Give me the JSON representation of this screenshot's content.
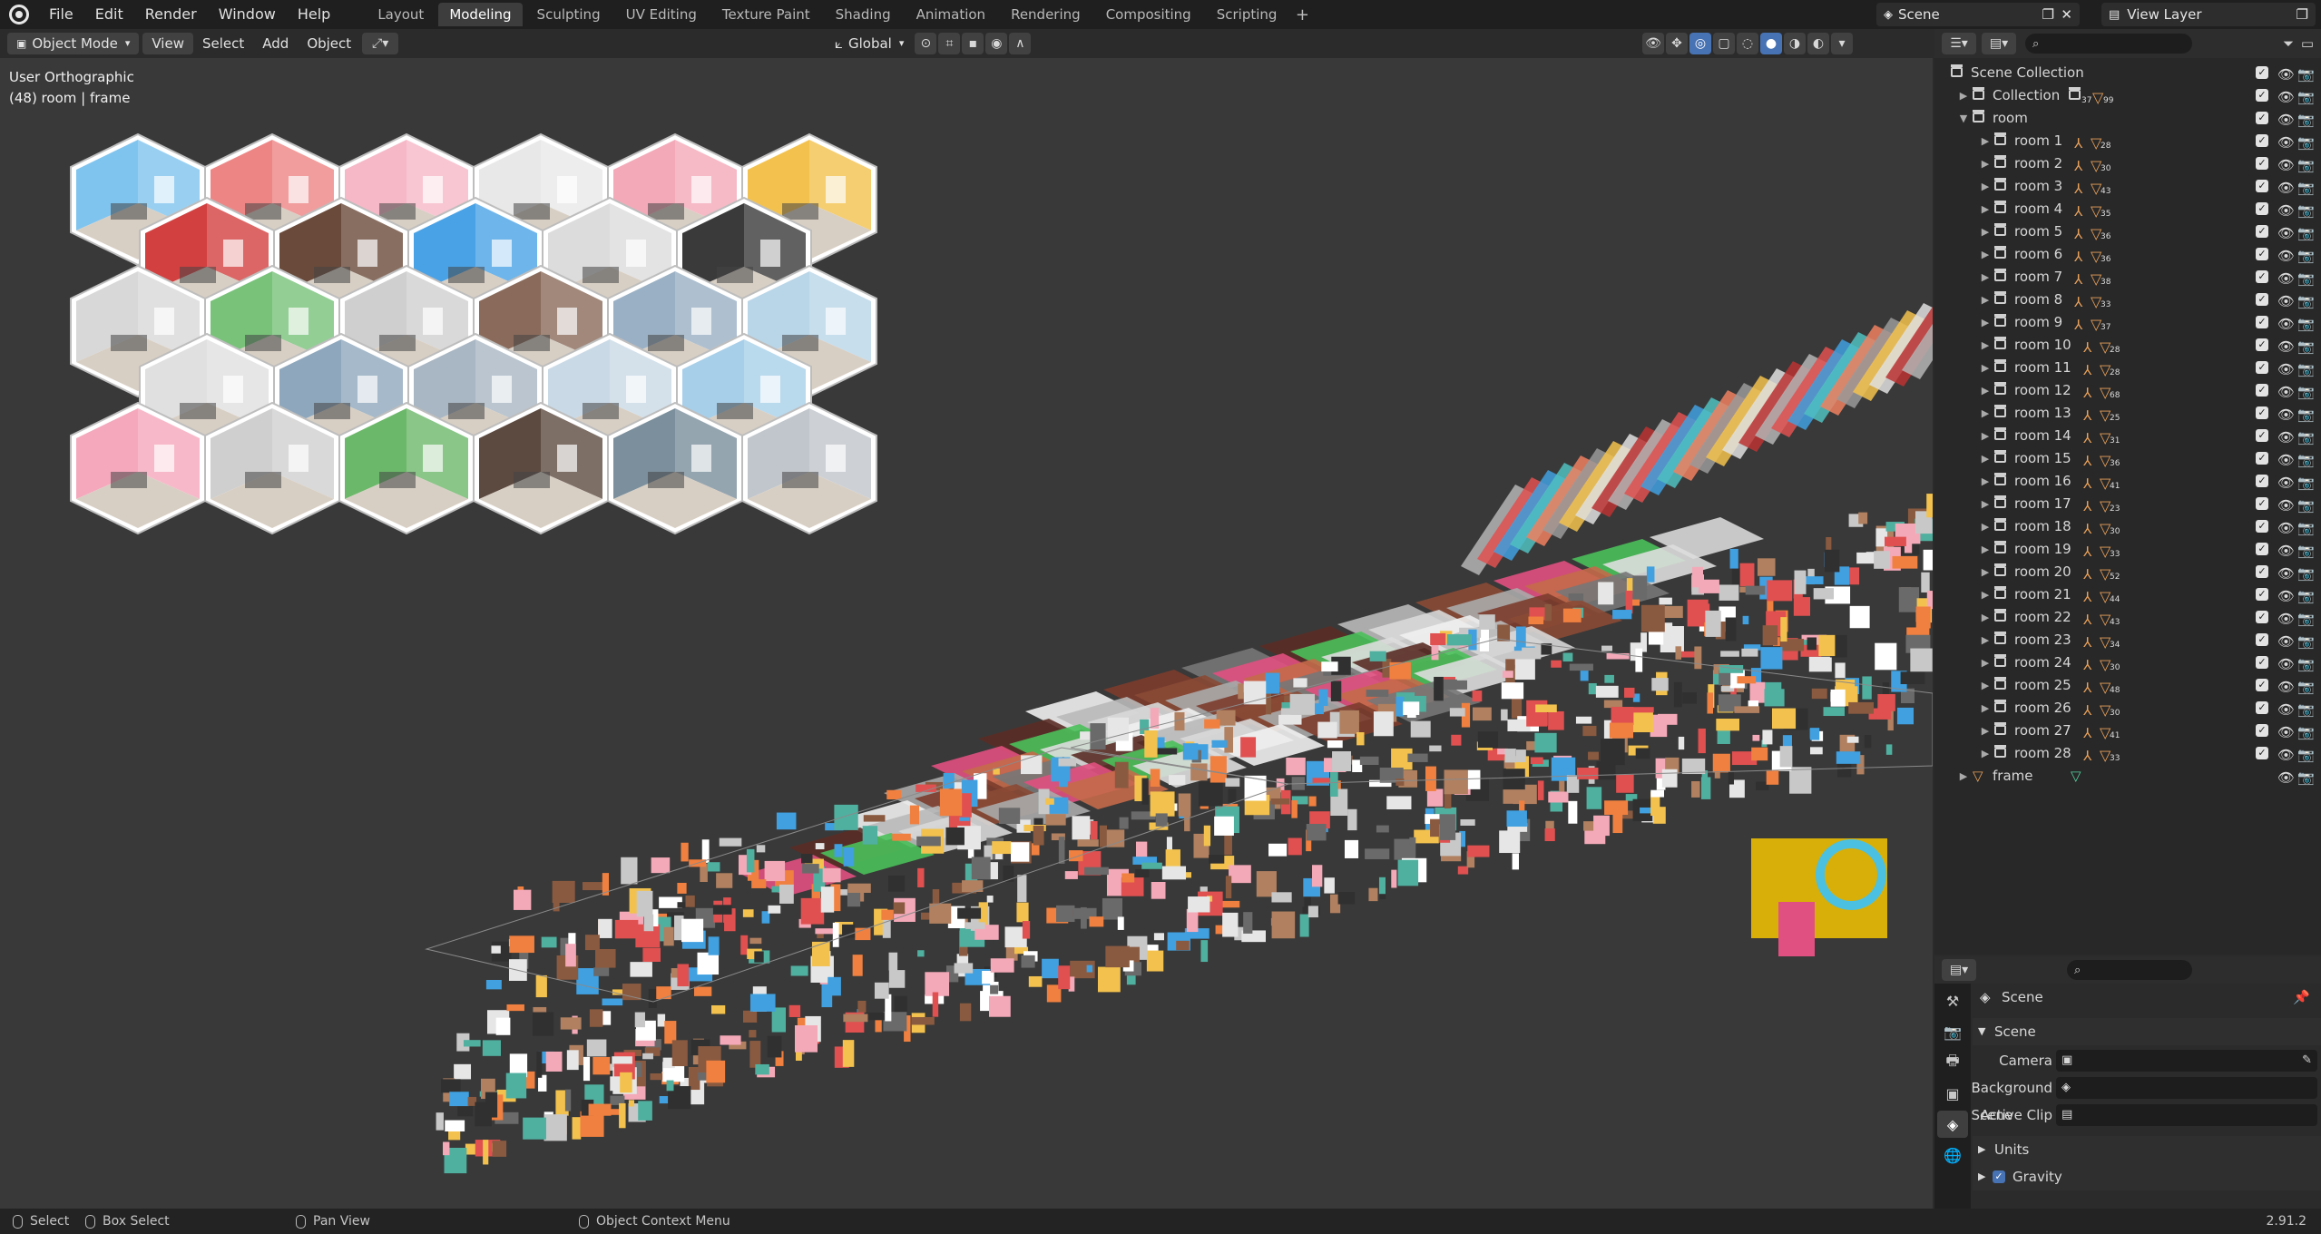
{
  "menu": {
    "file": "File",
    "edit": "Edit",
    "render": "Render",
    "window": "Window",
    "help": "Help"
  },
  "workspaces": [
    "Layout",
    "Modeling",
    "Sculpting",
    "UV Editing",
    "Texture Paint",
    "Shading",
    "Animation",
    "Rendering",
    "Compositing",
    "Scripting"
  ],
  "active_workspace": "Modeling",
  "scene_name": "Scene",
  "view_layer": "View Layer",
  "viewport_header": {
    "mode": "Object Mode",
    "view": "View",
    "select": "Select",
    "add": "Add",
    "object": "Object",
    "transform_orientation": "Global"
  },
  "viewport_info": {
    "view_name": "User Orthographic",
    "object_info": "(48) room | frame"
  },
  "outliner": {
    "root": "Scene Collection",
    "collection": {
      "label": "Collection",
      "count_a": "37",
      "count_b": "99"
    },
    "room_collection": "room",
    "rooms": [
      {
        "label": "room 1",
        "count": "28"
      },
      {
        "label": "room 2",
        "count": "30"
      },
      {
        "label": "room 3",
        "count": "43"
      },
      {
        "label": "room 4",
        "count": "35"
      },
      {
        "label": "room 5",
        "count": "36"
      },
      {
        "label": "room 6",
        "count": "36"
      },
      {
        "label": "room 7",
        "count": "38"
      },
      {
        "label": "room 8",
        "count": "33"
      },
      {
        "label": "room 9",
        "count": "37"
      },
      {
        "label": "room 10",
        "count": "28"
      },
      {
        "label": "room 11",
        "count": "28"
      },
      {
        "label": "room 12",
        "count": "68"
      },
      {
        "label": "room 13",
        "count": "25"
      },
      {
        "label": "room 14",
        "count": "31"
      },
      {
        "label": "room 15",
        "count": "36"
      },
      {
        "label": "room 16",
        "count": "41"
      },
      {
        "label": "room 17",
        "count": "23"
      },
      {
        "label": "room 18",
        "count": "30"
      },
      {
        "label": "room 19",
        "count": "33"
      },
      {
        "label": "room 20",
        "count": "52"
      },
      {
        "label": "room 21",
        "count": "44"
      },
      {
        "label": "room 22",
        "count": "43"
      },
      {
        "label": "room 23",
        "count": "34"
      },
      {
        "label": "room 24",
        "count": "30"
      },
      {
        "label": "room 25",
        "count": "48"
      },
      {
        "label": "room 26",
        "count": "30"
      },
      {
        "label": "room 27",
        "count": "41"
      },
      {
        "label": "room 28",
        "count": "33"
      }
    ],
    "frame": "frame"
  },
  "properties": {
    "context": "Scene",
    "panel_title": "Scene",
    "camera_label": "Camera",
    "background_label": "Background Scene",
    "clip_label": "Active Clip",
    "units_label": "Units",
    "gravity_label": "Gravity"
  },
  "status": {
    "select": "Select",
    "box_select": "Box Select",
    "pan_view": "Pan View",
    "context_menu": "Object Context Menu",
    "version": "2.91.2"
  },
  "colors": {
    "accent": "#4772b3",
    "selected_row": "#334d80",
    "object_orange": "#e8a05a"
  }
}
